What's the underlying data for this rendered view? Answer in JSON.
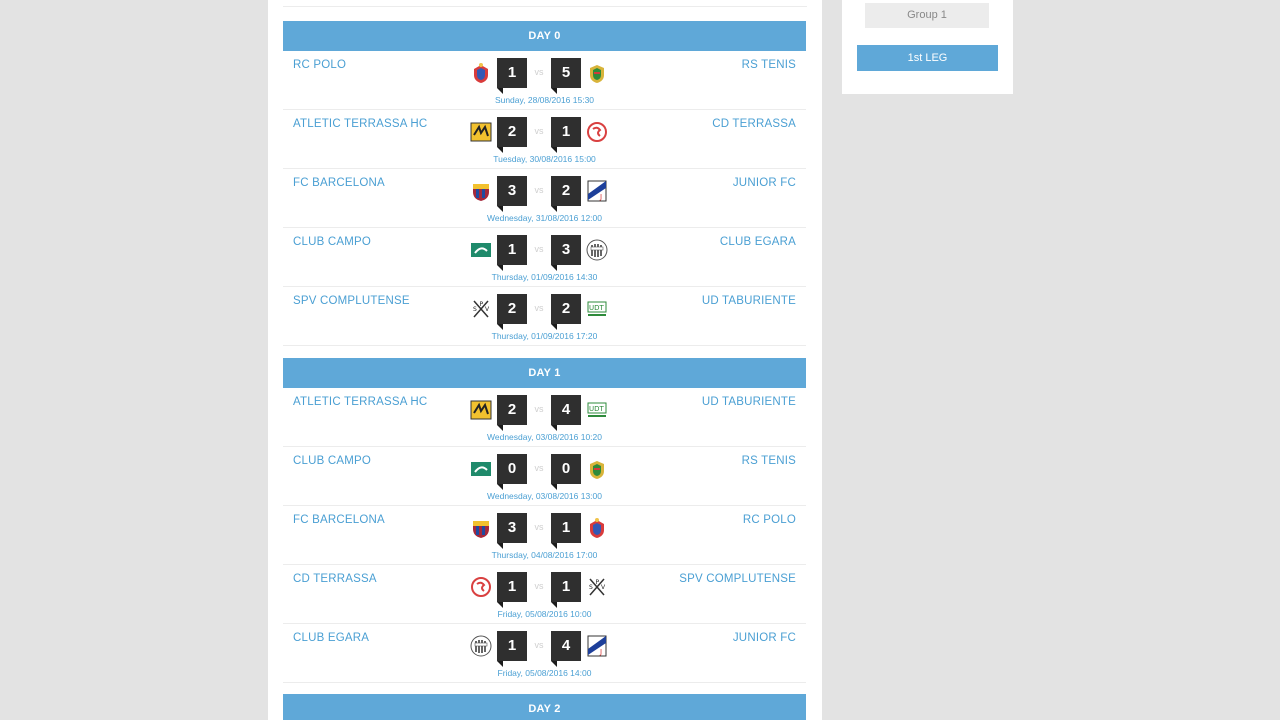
{
  "colors": {
    "accent": "#5fa8d8",
    "team_text": "#4a9fd3",
    "score_bg": "#2f2f2f",
    "page_bg": "#e3e3e3"
  },
  "sidebar": {
    "group_label": "Group 1",
    "leg_label": "1st LEG"
  },
  "vs_label": "vs",
  "days": [
    {
      "title": "DAY 0",
      "matches": [
        {
          "home": "RC POLO",
          "home_score": "1",
          "away": "RS TENIS",
          "away_score": "5",
          "date": "Sunday, 28/08/2016 15:30",
          "home_logo": "rc-polo-crest-icon",
          "away_logo": "rs-tenis-crest-icon"
        },
        {
          "home": "ATLETIC TERRASSA HC",
          "home_score": "2",
          "away": "CD TERRASSA",
          "away_score": "1",
          "date": "Tuesday, 30/08/2016 15:00",
          "home_logo": "atletic-terrassa-crest-icon",
          "away_logo": "cd-terrassa-crest-icon"
        },
        {
          "home": "FC BARCELONA",
          "home_score": "3",
          "away": "JUNIOR FC",
          "away_score": "2",
          "date": "Wednesday, 31/08/2016 12:00",
          "home_logo": "fc-barcelona-crest-icon",
          "away_logo": "junior-fc-crest-icon"
        },
        {
          "home": "CLUB CAMPO",
          "home_score": "1",
          "away": "CLUB EGARA",
          "away_score": "3",
          "date": "Thursday, 01/09/2016 14:30",
          "home_logo": "club-campo-crest-icon",
          "away_logo": "club-egara-crest-icon"
        },
        {
          "home": "SPV COMPLUTENSE",
          "home_score": "2",
          "away": "UD TABURIENTE",
          "away_score": "2",
          "date": "Thursday, 01/09/2016 17:20",
          "home_logo": "spv-complutense-crest-icon",
          "away_logo": "ud-taburiente-crest-icon"
        }
      ]
    },
    {
      "title": "DAY 1",
      "matches": [
        {
          "home": "ATLETIC TERRASSA HC",
          "home_score": "2",
          "away": "UD TABURIENTE",
          "away_score": "4",
          "date": "Wednesday, 03/08/2016 10:20",
          "home_logo": "atletic-terrassa-crest-icon",
          "away_logo": "ud-taburiente-crest-icon"
        },
        {
          "home": "CLUB CAMPO",
          "home_score": "0",
          "away": "RS TENIS",
          "away_score": "0",
          "date": "Wednesday, 03/08/2016 13:00",
          "home_logo": "club-campo-crest-icon",
          "away_logo": "rs-tenis-crest-icon"
        },
        {
          "home": "FC BARCELONA",
          "home_score": "3",
          "away": "RC POLO",
          "away_score": "1",
          "date": "Thursday, 04/08/2016 17:00",
          "home_logo": "fc-barcelona-crest-icon",
          "away_logo": "rc-polo-crest-icon"
        },
        {
          "home": "CD TERRASSA",
          "home_score": "1",
          "away": "SPV COMPLUTENSE",
          "away_score": "1",
          "date": "Friday, 05/08/2016 10:00",
          "home_logo": "cd-terrassa-crest-icon",
          "away_logo": "spv-complutense-crest-icon"
        },
        {
          "home": "CLUB EGARA",
          "home_score": "1",
          "away": "JUNIOR FC",
          "away_score": "4",
          "date": "Friday, 05/08/2016 14:00",
          "home_logo": "club-egara-crest-icon",
          "away_logo": "junior-fc-crest-icon"
        }
      ]
    },
    {
      "title": "DAY 2",
      "matches": []
    }
  ]
}
